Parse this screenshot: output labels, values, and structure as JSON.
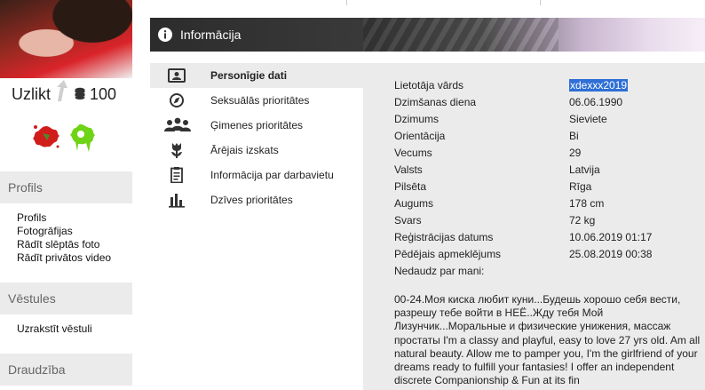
{
  "profile": {
    "action_label": "Uzlikt",
    "score": "100"
  },
  "sidebar": {
    "sections": [
      {
        "title": "Profils",
        "links": [
          "Profils",
          "Fotogrāfijas",
          "Rādīt slēptās foto",
          "Rādīt privātos video"
        ]
      },
      {
        "title": "Vēstules",
        "links": [
          "Uzrakstīt vēstuli"
        ]
      },
      {
        "title": "Draudzība",
        "links": []
      }
    ]
  },
  "banner": {
    "title": "Informācija",
    "icon": "info-icon"
  },
  "menu": {
    "items": [
      {
        "label": "Personīgie dati",
        "icon": "id-card-icon",
        "active": true
      },
      {
        "label": "Seksuālās prioritātes",
        "icon": "compass-icon"
      },
      {
        "label": "Ģimenes prioritātes",
        "icon": "family-icon"
      },
      {
        "label": "Ārējais izskats",
        "icon": "tulip-icon"
      },
      {
        "label": "Informācija par darbavietu",
        "icon": "clipboard-icon"
      },
      {
        "label": "Dzīves prioritātes",
        "icon": "bar-chart-icon"
      }
    ]
  },
  "details": {
    "rows": [
      {
        "key": "Lietotāja vārds",
        "value": "xdexxx2019"
      },
      {
        "key": "Dzimšanas diena",
        "value": "06.06.1990"
      },
      {
        "key": "Dzimums",
        "value": "Sieviete"
      },
      {
        "key": "Orientācija",
        "value": "Bi"
      },
      {
        "key": "Vecums",
        "value": "29"
      },
      {
        "key": "Valsts",
        "value": "Latvija"
      },
      {
        "key": "Pilsēta",
        "value": "Rīga"
      },
      {
        "key": "Augums",
        "value": "178 cm"
      },
      {
        "key": "Svars",
        "value": "72 kg"
      },
      {
        "key": "Reģistrācijas datums",
        "value": "10.06.2019 01:17"
      },
      {
        "key": "Pēdējais apmeklējums",
        "value": "25.08.2019 00:38"
      },
      {
        "key": "Nedaudz par mani:",
        "value": ""
      }
    ],
    "about": "00-24.Моя киска любит куни...Будешь хорошо себя вести, разрешу тебе войти в НЕЁ..Жду тебя Мой Лизунчик...Моральные и физические унижения, массаж простаты I'm a classy and playful, easy to love 27 yrs old. Am all natural beauty. Allow me to pamper you, I'm the girlfriend of your dreams ready to fulfill your fantasies! I offer an independent discrete Companionship & Fun at its fin"
  },
  "colors": {
    "selection": "#2f6fd6",
    "panel": "#ebebeb",
    "banner_text": "#ffffff"
  }
}
